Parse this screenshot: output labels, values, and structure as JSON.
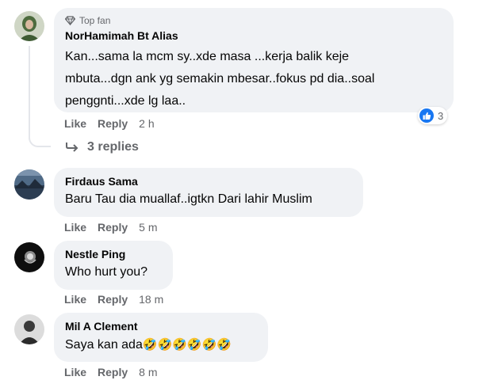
{
  "comments": [
    {
      "badge": "Top fan",
      "name": "NorHamimah Bt Alias",
      "text_lines": [
        "Kan...sama la mcm sy..xde masa ...kerja balik keje",
        "mbuta...dgn ank yg semakin mbesar..fokus pd dia..soal",
        "penggnti...xde lg laa.."
      ],
      "like": "Like",
      "reply": "Reply",
      "time": "2 h",
      "reaction_count": "3",
      "replies_label": "3 replies"
    },
    {
      "name": "Firdaus Sama",
      "text": "Baru Tau dia muallaf..igtkn Dari lahir Muslim",
      "like": "Like",
      "reply": "Reply",
      "time": "5 m"
    },
    {
      "name": "Nestle Ping",
      "text": "Who hurt you?",
      "like": "Like",
      "reply": "Reply",
      "time": "18 m"
    },
    {
      "name": "Mil A Clement",
      "text": "Saya kan ada",
      "emojis": "🤣🤣🤣🤣🤣🤣",
      "like": "Like",
      "reply": "Reply",
      "time": "8 m"
    }
  ],
  "colors": {
    "bubble": "#f0f2f5",
    "muted": "#65676b",
    "like_blue": "#1877f2"
  },
  "icons": [
    "top-fan-diamond-icon",
    "reply-arrow-icon",
    "like-thumb-icon"
  ]
}
